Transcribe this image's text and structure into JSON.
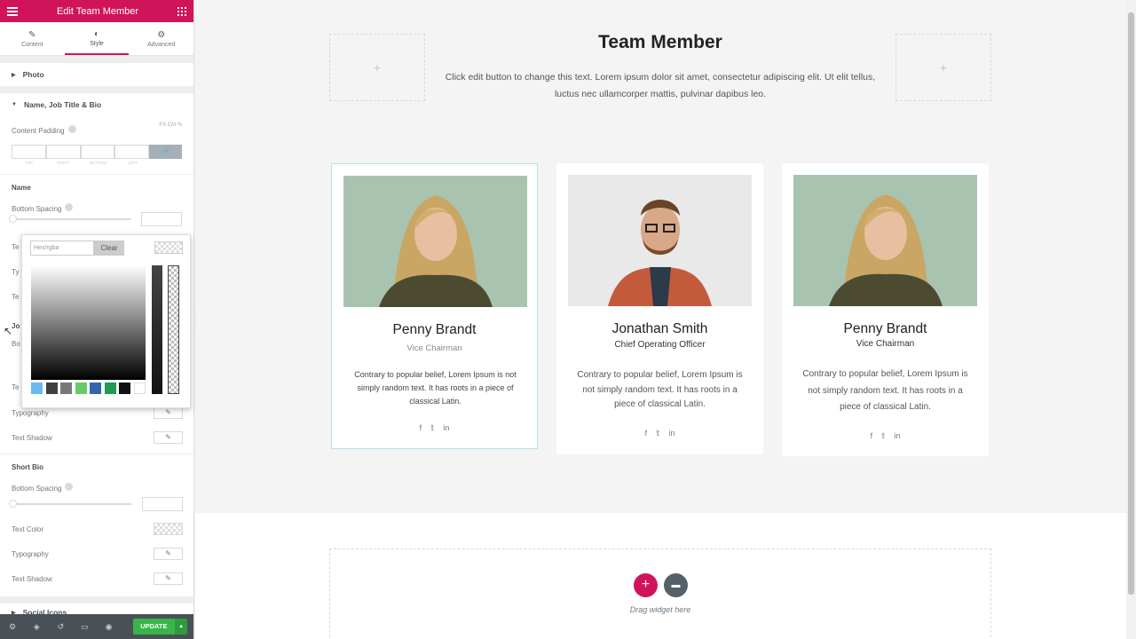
{
  "panel": {
    "title": "Edit Team Member",
    "tabs": [
      {
        "label": "Content",
        "icon": "pencil-icon",
        "glyph": "✎"
      },
      {
        "label": "Style",
        "icon": "contrast-icon",
        "glyph": "◐"
      },
      {
        "label": "Advanced",
        "icon": "gear-icon",
        "glyph": "⚙"
      }
    ],
    "sections": {
      "photo": "Photo",
      "name_job": "Name, Job Title & Bio",
      "social": "Social Icons"
    },
    "content_padding": {
      "label": "Content Padding",
      "units": "PX  EM  %",
      "dims": [
        "TOP",
        "RIGHT",
        "BOTTOM",
        "LEFT"
      ]
    },
    "name": {
      "heading": "Name",
      "bottom_spacing": "Bottom Spacing"
    },
    "job": {
      "typography": "Typography",
      "text_shadow": "Text Shadow"
    },
    "bio": {
      "heading": "Short Bio",
      "bottom_spacing": "Bottom Spacing",
      "text_color": "Text Color",
      "typography": "Typography",
      "text_shadow": "Text Shadow"
    },
    "hidden_labels": {
      "te": "Te",
      "ty": "Ty",
      "jo": "Jo",
      "bo": "Bo"
    },
    "footer": {
      "update": "UPDATE"
    }
  },
  "picker": {
    "placeholder": "Hex/rgba",
    "clear": "Clear",
    "swatches": [
      "#6bb9f0",
      "#404040",
      "#777777",
      "#66cc66",
      "#3366aa",
      "#229955",
      "#111111",
      "#ffffff"
    ]
  },
  "canvas": {
    "title": "Team Member",
    "intro": "Click edit button to change this text. Lorem ipsum dolor sit amet, consectetur adipiscing elit. Ut elit tellus, luctus nec ullamcorper mattis, pulvinar dapibus leo.",
    "members": [
      {
        "name": "Penny Brandt",
        "role": "Vice Chairman",
        "bio": "Contrary to popular belief, Lorem Ipsum is not simply random text. It has roots in a piece of classical Latin."
      },
      {
        "name": "Jonathan Smith",
        "role": "Chief Operating Officer",
        "bio": "Contrary to popular belief, Lorem Ipsum is not simply random text. It has roots in a piece of classical Latin."
      },
      {
        "name": "Penny Brandt",
        "role": "Vice Chairman",
        "bio": "Contrary to popular belief, Lorem Ipsum is not simply random text. It has roots in a piece of classical Latin."
      }
    ],
    "social": {
      "facebook": "f",
      "twitter": "𝕥",
      "linkedin": "in"
    },
    "drag_text": "Drag widget here"
  }
}
